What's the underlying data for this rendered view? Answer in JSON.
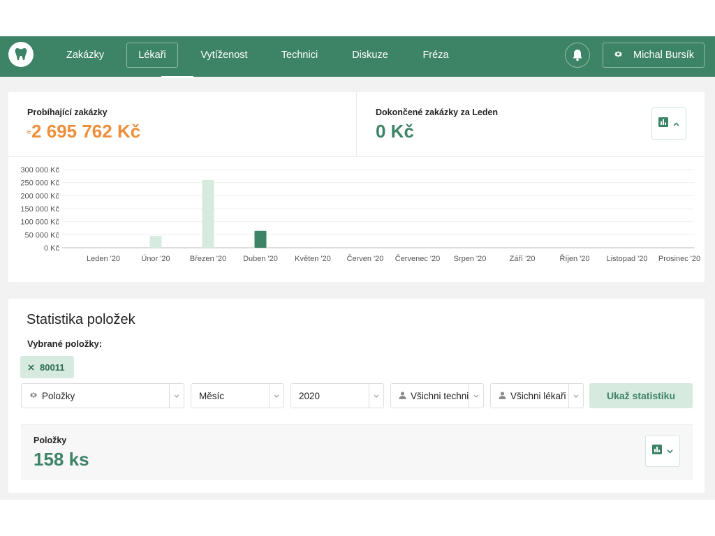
{
  "nav": {
    "items": [
      {
        "label": "Zakázky"
      },
      {
        "label": "Lékaři"
      },
      {
        "label": "Vytíženost"
      },
      {
        "label": "Technici"
      },
      {
        "label": "Diskuze"
      },
      {
        "label": "Fréza"
      }
    ],
    "active_index": 1,
    "user_name": "Michal Bursík"
  },
  "stats": {
    "running_label": "Probíhající zakázky",
    "running_prefix": "≈",
    "running_value": "2 695 762 Kč",
    "finished_label": "Dokončené zakázky za Leden",
    "finished_value": "0 Kč"
  },
  "chart_data": {
    "type": "bar",
    "categories": [
      "Leden '20",
      "Únor '20",
      "Březen '20",
      "Duben '20",
      "Květen '20",
      "Červen '20",
      "Červenec '20",
      "Srpen '20",
      "Září '20",
      "Říjen '20",
      "Listopad '20",
      "Prosinec '20"
    ],
    "series": [
      {
        "values": [
          0,
          45000,
          260000,
          0,
          0,
          0,
          0,
          0,
          0,
          0,
          0,
          0
        ],
        "color": "#d6eadf"
      },
      {
        "values": [
          0,
          0,
          0,
          65000,
          0,
          0,
          0,
          0,
          0,
          0,
          0,
          0
        ],
        "color": "#3d8366"
      }
    ],
    "ylim": [
      0,
      300000
    ],
    "yticks": [
      "0 Kč",
      "50 000 Kč",
      "100 000 Kč",
      "150 000 Kč",
      "200 000 Kč",
      "250 000 Kč",
      "300 000 Kč"
    ],
    "grid": true
  },
  "items_section": {
    "title": "Statistika položek",
    "selected_label": "Vybrané položky:",
    "chip": "80011",
    "filters": {
      "category": "Položky",
      "period": "Měsíc",
      "year": "2020",
      "technician": "Všichni technici",
      "doctor": "Všichni lékaři"
    },
    "button": "Ukaž statistiku",
    "summary_label": "Položky",
    "summary_value": "158 ks"
  },
  "colors": {
    "brand": "#3d8366",
    "accent_orange": "#ec8f3b",
    "light_green": "#d6eadf"
  }
}
